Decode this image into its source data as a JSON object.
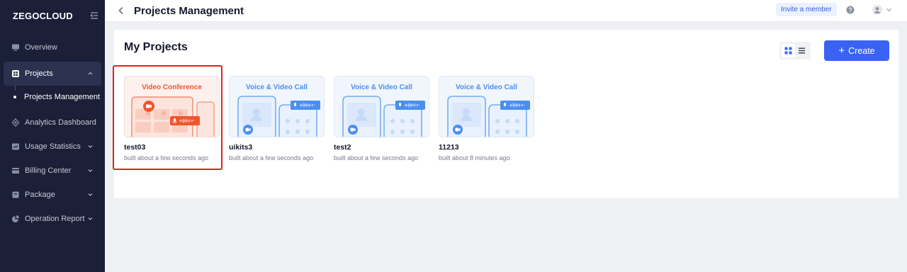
{
  "sidebar": {
    "logo": "ZEGOCLOUD",
    "items": [
      {
        "label": "Overview"
      },
      {
        "label": "Projects"
      },
      {
        "label": "Projects Management"
      },
      {
        "label": "Analytics Dashboard"
      },
      {
        "label": "Usage Statistics"
      },
      {
        "label": "Billing Center"
      },
      {
        "label": "Package"
      },
      {
        "label": "Operation Report"
      }
    ]
  },
  "header": {
    "title": "Projects Management",
    "invite_label": "Invite a member"
  },
  "main": {
    "title": "My Projects",
    "create_label": "Create",
    "projects": [
      {
        "name": "test03",
        "time": "built about a few seconds ago",
        "thumb_title": "Video Conference"
      },
      {
        "name": "uikits3",
        "time": "built about a few seconds ago",
        "thumb_title": "Voice & Video Call"
      },
      {
        "name": "test2",
        "time": "built about a few seconds ago",
        "thumb_title": "Voice & Video Call"
      },
      {
        "name": "11213",
        "time": "built about 8 minutes ago",
        "thumb_title": "Voice & Video Call"
      }
    ]
  },
  "colors": {
    "sidebar_bg": "#1b1f37",
    "accent": "#3a63f3",
    "conference": "#f0552e",
    "call": "#4a8ff0",
    "highlight": "#e02020"
  },
  "icons": [
    "collapse-icon",
    "monitor-icon",
    "grid-icon",
    "analytics-icon",
    "chart-icon",
    "card-icon",
    "package-icon",
    "pie-icon",
    "back-icon",
    "help-icon",
    "user-icon",
    "grid-view-icon",
    "list-view-icon",
    "camera-icon",
    "mic-icon"
  ]
}
